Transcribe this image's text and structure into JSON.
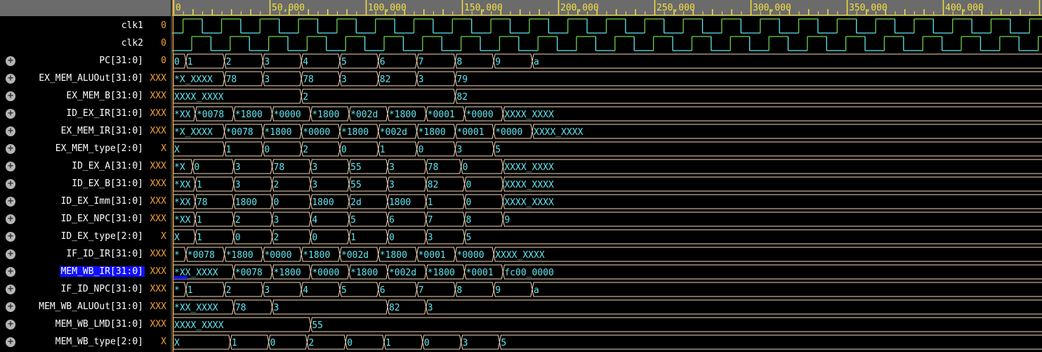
{
  "ruler": {
    "labels": [
      "0",
      "50,000",
      "100,000",
      "150,000",
      "200,000",
      "250,000",
      "300,000",
      "350,000",
      "400,000"
    ],
    "label_times": [
      0,
      50000,
      100000,
      150000,
      200000,
      250000,
      300000,
      350000,
      400000
    ],
    "minor_step": 5000
  },
  "colors": {
    "clock_high": "#6fd24a",
    "clock_low": "#5fe6f0",
    "bus_outline": "#f4d7b6",
    "bus_text": "#5fe6f0",
    "value": "#f0a030",
    "ruler_bg": "#6b6b6b",
    "ruler_tick": "#f0e040",
    "cursor": "#e0a040",
    "selected": "#1010ff"
  },
  "clock": {
    "period": 20000
  },
  "signals": [
    {
      "name": "clk1",
      "value": "0",
      "type": "clock",
      "first_rise": 5000,
      "expandable": false
    },
    {
      "name": "clk2",
      "value": "0",
      "type": "clock",
      "first_rise": 9500,
      "expandable": false
    },
    {
      "name": "PC[31:0]",
      "value": "0",
      "type": "bus",
      "segs": [
        [
          0,
          "0"
        ],
        [
          6500,
          "1"
        ],
        [
          26500,
          "2"
        ],
        [
          46500,
          "3"
        ],
        [
          66500,
          "4"
        ],
        [
          86500,
          "5"
        ],
        [
          106500,
          "6"
        ],
        [
          126500,
          "7"
        ],
        [
          146500,
          "8"
        ],
        [
          166500,
          "9"
        ],
        [
          186500,
          "a"
        ]
      ]
    },
    {
      "name": "EX_MEM_ALUOut[31:0]",
      "value": "XXX",
      "type": "bus",
      "segs": [
        [
          0,
          "*X_XXXX"
        ],
        [
          26500,
          "78"
        ],
        [
          46500,
          "3"
        ],
        [
          66500,
          "78"
        ],
        [
          86500,
          "3"
        ],
        [
          106500,
          "82"
        ],
        [
          126500,
          "3"
        ],
        [
          146500,
          "79"
        ]
      ]
    },
    {
      "name": "EX_MEM_B[31:0]",
      "value": "XXX",
      "type": "bus",
      "segs": [
        [
          0,
          "XXXX_XXXX"
        ],
        [
          66500,
          "2"
        ],
        [
          146500,
          "82"
        ]
      ]
    },
    {
      "name": "ID_EX_IR[31:0]",
      "value": "XXX",
      "type": "bus",
      "segs": [
        [
          0,
          "*XX"
        ],
        [
          11300,
          "*0078"
        ],
        [
          31300,
          "*1800"
        ],
        [
          51300,
          "*0000"
        ],
        [
          71300,
          "*1800"
        ],
        [
          91300,
          "*002d"
        ],
        [
          111300,
          "*1800"
        ],
        [
          131300,
          "*0001"
        ],
        [
          151300,
          "*0000"
        ],
        [
          171300,
          "XXXX_XXXX"
        ]
      ]
    },
    {
      "name": "EX_MEM_IR[31:0]",
      "value": "XXX",
      "type": "bus",
      "segs": [
        [
          0,
          "*X_XXXX"
        ],
        [
          26500,
          "*0078"
        ],
        [
          46500,
          "*1800"
        ],
        [
          66500,
          "*0000"
        ],
        [
          86500,
          "*1800"
        ],
        [
          106500,
          "*002d"
        ],
        [
          126500,
          "*1800"
        ],
        [
          146500,
          "*0001"
        ],
        [
          166500,
          "*0000"
        ],
        [
          186500,
          "XXXX_XXXX"
        ]
      ]
    },
    {
      "name": "EX_MEM_type[2:0]",
      "value": "X",
      "type": "bus",
      "segs": [
        [
          0,
          "X"
        ],
        [
          26500,
          "1"
        ],
        [
          46500,
          "0"
        ],
        [
          66500,
          "2"
        ],
        [
          86500,
          "0"
        ],
        [
          106500,
          "1"
        ],
        [
          126500,
          "0"
        ],
        [
          146500,
          "3"
        ],
        [
          166500,
          "5"
        ]
      ]
    },
    {
      "name": "ID_EX_A[31:0]",
      "value": "XXX",
      "type": "bus",
      "segs": [
        [
          0,
          "*X"
        ],
        [
          10000,
          "0"
        ],
        [
          31300,
          "3"
        ],
        [
          51300,
          "78"
        ],
        [
          71300,
          "3"
        ],
        [
          91300,
          "55"
        ],
        [
          111300,
          "3"
        ],
        [
          131300,
          "78"
        ],
        [
          149500,
          "0"
        ],
        [
          171300,
          "XXXX_XXXX"
        ]
      ]
    },
    {
      "name": "ID_EX_B[31:0]",
      "value": "XXX",
      "type": "bus",
      "segs": [
        [
          0,
          "*XX"
        ],
        [
          11300,
          "1"
        ],
        [
          31300,
          "3"
        ],
        [
          51300,
          "2"
        ],
        [
          71300,
          "3"
        ],
        [
          91300,
          "55"
        ],
        [
          111300,
          "3"
        ],
        [
          131300,
          "82"
        ],
        [
          151300,
          "0"
        ],
        [
          171300,
          "XXXX_XXXX"
        ]
      ]
    },
    {
      "name": "ID_EX_Imm[31:0]",
      "value": "XXX",
      "type": "bus",
      "segs": [
        [
          0,
          "*XX"
        ],
        [
          11300,
          "78"
        ],
        [
          31300,
          "1800"
        ],
        [
          51300,
          "0"
        ],
        [
          71300,
          "1800"
        ],
        [
          91300,
          "2d"
        ],
        [
          111300,
          "1800"
        ],
        [
          131300,
          "1"
        ],
        [
          151300,
          "0"
        ],
        [
          171300,
          "XXXX_XXXX"
        ]
      ]
    },
    {
      "name": "ID_EX_NPC[31:0]",
      "value": "XXX",
      "type": "bus",
      "segs": [
        [
          0,
          "*XX"
        ],
        [
          11300,
          "1"
        ],
        [
          31300,
          "2"
        ],
        [
          51300,
          "3"
        ],
        [
          71300,
          "4"
        ],
        [
          91300,
          "5"
        ],
        [
          111300,
          "6"
        ],
        [
          131300,
          "7"
        ],
        [
          151300,
          "8"
        ],
        [
          171300,
          "9"
        ]
      ]
    },
    {
      "name": "ID_EX_type[2:0]",
      "value": "X",
      "type": "bus",
      "segs": [
        [
          0,
          "X"
        ],
        [
          11300,
          "1"
        ],
        [
          31300,
          "0"
        ],
        [
          51300,
          "2"
        ],
        [
          71300,
          "0"
        ],
        [
          91300,
          "1"
        ],
        [
          111300,
          "0"
        ],
        [
          131300,
          "3"
        ],
        [
          151300,
          "5"
        ]
      ]
    },
    {
      "name": "IF_ID_IR[31:0]",
      "value": "XXX",
      "type": "bus",
      "segs": [
        [
          0,
          "*"
        ],
        [
          6500,
          "*0078"
        ],
        [
          26500,
          "*1800"
        ],
        [
          46500,
          "*0000"
        ],
        [
          66500,
          "*1800"
        ],
        [
          86500,
          "*002d"
        ],
        [
          106500,
          "*1800"
        ],
        [
          126500,
          "*0001"
        ],
        [
          146500,
          "*0000"
        ],
        [
          166500,
          "XXXX_XXXX"
        ]
      ]
    },
    {
      "name": "MEM_WB_IR[31:0]",
      "value": "XXX",
      "type": "bus",
      "selected": true,
      "segs": [
        [
          0,
          "*XX_XXXX"
        ],
        [
          31300,
          "*0078"
        ],
        [
          51300,
          "*1800"
        ],
        [
          71300,
          "*0000"
        ],
        [
          91300,
          "*1800"
        ],
        [
          111300,
          "*002d"
        ],
        [
          131300,
          "*1800"
        ],
        [
          151300,
          "*0001"
        ],
        [
          171300,
          "fc00_0000"
        ]
      ]
    },
    {
      "name": "IF_ID_NPC[31:0]",
      "value": "XXX",
      "type": "bus",
      "segs": [
        [
          0,
          "*"
        ],
        [
          6500,
          "1"
        ],
        [
          26500,
          "2"
        ],
        [
          46500,
          "3"
        ],
        [
          66500,
          "4"
        ],
        [
          86500,
          "5"
        ],
        [
          106500,
          "6"
        ],
        [
          126500,
          "7"
        ],
        [
          146500,
          "8"
        ],
        [
          166500,
          "9"
        ],
        [
          186500,
          "a"
        ]
      ]
    },
    {
      "name": "MEM_WB_ALUOut[31:0]",
      "value": "XXX",
      "type": "bus",
      "segs": [
        [
          0,
          "*XX_XXXX"
        ],
        [
          31300,
          "78"
        ],
        [
          51300,
          "3"
        ],
        [
          111300,
          "82"
        ],
        [
          131300,
          "3"
        ]
      ]
    },
    {
      "name": "MEM_WB_LMD[31:0]",
      "value": "XXX",
      "type": "bus",
      "segs": [
        [
          0,
          "XXXX_XXXX"
        ],
        [
          71300,
          "55"
        ]
      ]
    },
    {
      "name": "MEM_WB_type[2:0]",
      "value": "X",
      "type": "bus",
      "segs": [
        [
          0,
          "X"
        ],
        [
          29500,
          "1"
        ],
        [
          49500,
          "0"
        ],
        [
          69500,
          "2"
        ],
        [
          89500,
          "0"
        ],
        [
          109500,
          "1"
        ],
        [
          129500,
          "0"
        ],
        [
          149500,
          "3"
        ],
        [
          169500,
          "5"
        ]
      ]
    }
  ]
}
